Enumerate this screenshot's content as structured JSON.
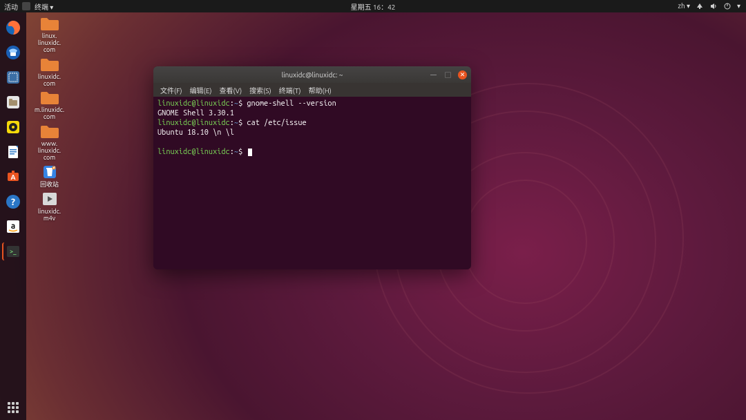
{
  "topbar": {
    "activities": "活动",
    "app_label": "终端 ▾",
    "clock": "星期五 16：42",
    "input_method": "zh ▾"
  },
  "dock": {
    "items": [
      {
        "name": "firefox-icon"
      },
      {
        "name": "thunderbird-icon"
      },
      {
        "name": "screenshot-icon"
      },
      {
        "name": "files-icon"
      },
      {
        "name": "rhythmbox-icon"
      },
      {
        "name": "libreoffice-writer-icon"
      },
      {
        "name": "ubuntu-software-icon"
      },
      {
        "name": "help-icon"
      },
      {
        "name": "amazon-icon"
      },
      {
        "name": "terminal-icon"
      }
    ]
  },
  "desktop": {
    "icons": [
      {
        "type": "folder",
        "label": "linux.\nlinuxidc.\ncom"
      },
      {
        "type": "folder",
        "label": "linuxidc.\ncom"
      },
      {
        "type": "folder",
        "label": "m.linuxidc.\ncom"
      },
      {
        "type": "folder",
        "label": "www.\nlinuxidc.\ncom"
      },
      {
        "type": "trash",
        "label": "回收站"
      },
      {
        "type": "video",
        "label": "linuxidc.\nm4v"
      }
    ]
  },
  "terminal": {
    "title": "linuxidc@linuxidc: ~",
    "menus": [
      "文件(F)",
      "编辑(E)",
      "查看(V)",
      "搜索(S)",
      "终端(T)",
      "帮助(H)"
    ],
    "lines": [
      {
        "prompt": "linuxidc@linuxidc",
        "path": "~",
        "cmd": "gnome-shell --version"
      },
      {
        "out": "GNOME Shell 3.30.1"
      },
      {
        "prompt": "linuxidc@linuxidc",
        "path": "~",
        "cmd": "cat /etc/issue"
      },
      {
        "out": "Ubuntu 18.10 \\n \\l"
      },
      {
        "out": ""
      },
      {
        "prompt": "linuxidc@linuxidc",
        "path": "~",
        "cmd": "",
        "cursor": true
      }
    ]
  }
}
